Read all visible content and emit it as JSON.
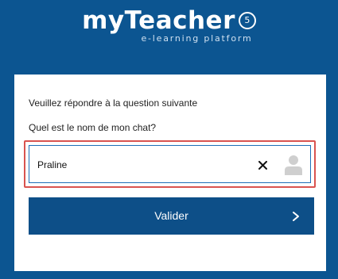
{
  "brand": {
    "name": "myTeacher",
    "badge": "5",
    "tagline": "e-learning platform"
  },
  "form": {
    "prompt": "Veuillez répondre à la question suivante",
    "question": "Quel est le nom de mon chat?",
    "answer_value": "Praline",
    "clear_icon": "close-icon",
    "user_icon": "user-icon",
    "submit_label": "Valider",
    "submit_icon": "chevron-right-icon"
  },
  "colors": {
    "background": "#0c5591",
    "card": "#ffffff",
    "button": "#0d4f88",
    "field_border": "#1f6fb8",
    "highlight_border": "#d9534f"
  }
}
